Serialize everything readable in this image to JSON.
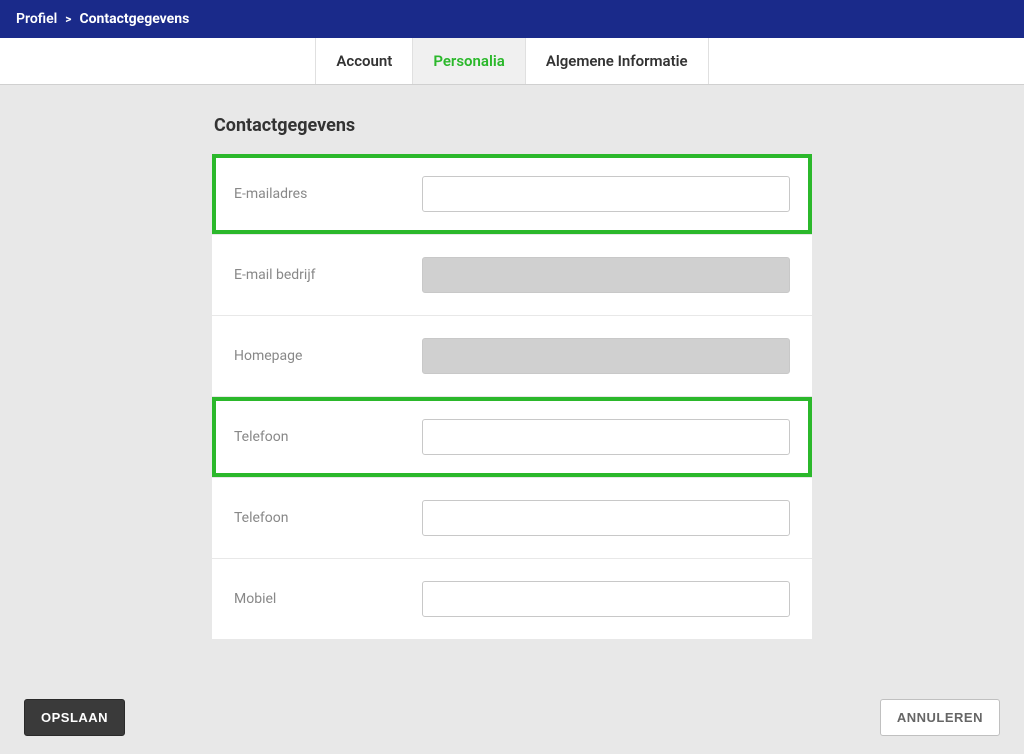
{
  "breadcrumb": {
    "parent": "Profiel",
    "separator": ">",
    "current": "Contactgegevens"
  },
  "tabs": {
    "account": "Account",
    "personalia": "Personalia",
    "algemene": "Algemene Informatie"
  },
  "section": {
    "title": "Contactgegevens"
  },
  "fields": {
    "email": {
      "label": "E-mailadres",
      "value": ""
    },
    "email_company": {
      "label": "E-mail bedrijf",
      "value": ""
    },
    "homepage": {
      "label": "Homepage",
      "value": ""
    },
    "telefoon1": {
      "label": "Telefoon",
      "value": ""
    },
    "telefoon2": {
      "label": "Telefoon",
      "value": ""
    },
    "mobiel": {
      "label": "Mobiel",
      "value": ""
    }
  },
  "buttons": {
    "save": "OPSLAAN",
    "cancel": "ANNULEREN"
  }
}
